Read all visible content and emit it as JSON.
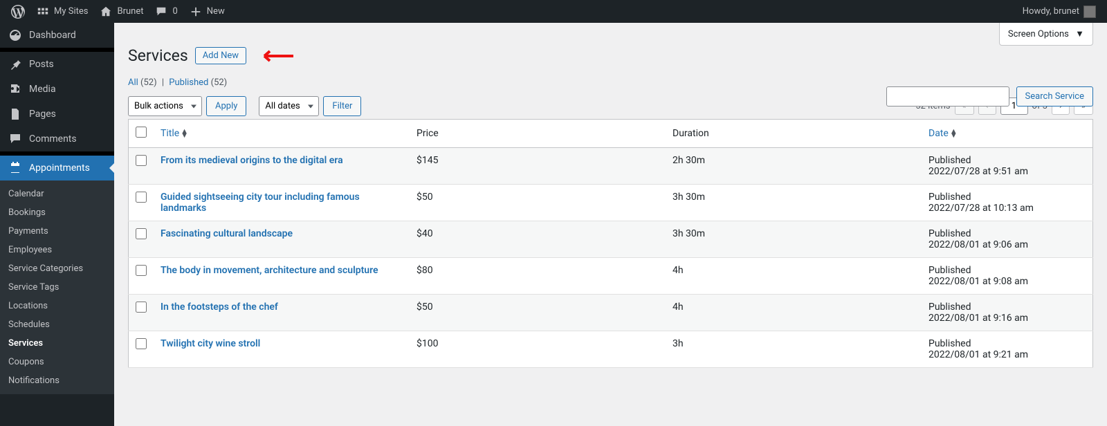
{
  "topbar": {
    "my_sites": "My Sites",
    "site_name": "Brunet",
    "comment_count": "0",
    "new": "New",
    "howdy": "Howdy, brunet"
  },
  "sidebar": {
    "items": [
      {
        "label": "Dashboard"
      },
      {
        "label": "Posts"
      },
      {
        "label": "Media"
      },
      {
        "label": "Pages"
      },
      {
        "label": "Comments"
      },
      {
        "label": "Appointments"
      }
    ],
    "submenu": [
      {
        "label": "Calendar"
      },
      {
        "label": "Bookings"
      },
      {
        "label": "Payments"
      },
      {
        "label": "Employees"
      },
      {
        "label": "Service Categories"
      },
      {
        "label": "Service Tags"
      },
      {
        "label": "Locations"
      },
      {
        "label": "Schedules"
      },
      {
        "label": "Services"
      },
      {
        "label": "Coupons"
      },
      {
        "label": "Notifications"
      }
    ]
  },
  "header": {
    "title": "Services",
    "add_new": "Add New",
    "screen_options": "Screen Options"
  },
  "subsubsub": {
    "all_label": "All",
    "all_count": "(52)",
    "published_label": "Published",
    "published_count": "(52)"
  },
  "filters": {
    "bulk_actions": "Bulk actions",
    "apply": "Apply",
    "all_dates": "All dates",
    "filter": "Filter"
  },
  "search": {
    "button": "Search Service"
  },
  "pagination": {
    "items": "52 items",
    "current_page": "1",
    "of": "of 3"
  },
  "columns": {
    "title": "Title",
    "price": "Price",
    "duration": "Duration",
    "date": "Date"
  },
  "rows": [
    {
      "title": "From its medieval origins to the digital era",
      "price": "$145",
      "duration": "2h 30m",
      "status": "Published",
      "date": "2022/07/28 at 9:51 am"
    },
    {
      "title": "Guided sightseeing city tour including famous landmarks",
      "price": "$50",
      "duration": "3h 30m",
      "status": "Published",
      "date": "2022/07/28 at 10:13 am"
    },
    {
      "title": "Fascinating cultural landscape",
      "price": "$40",
      "duration": "3h 30m",
      "status": "Published",
      "date": "2022/08/01 at 9:06 am"
    },
    {
      "title": "The body in movement, architecture and sculpture",
      "price": "$80",
      "duration": "4h",
      "status": "Published",
      "date": "2022/08/01 at 9:08 am"
    },
    {
      "title": "In the footsteps of the chef",
      "price": "$50",
      "duration": "4h",
      "status": "Published",
      "date": "2022/08/01 at 9:16 am"
    },
    {
      "title": "Twilight city wine stroll",
      "price": "$100",
      "duration": "3h",
      "status": "Published",
      "date": "2022/08/01 at 9:21 am"
    }
  ]
}
